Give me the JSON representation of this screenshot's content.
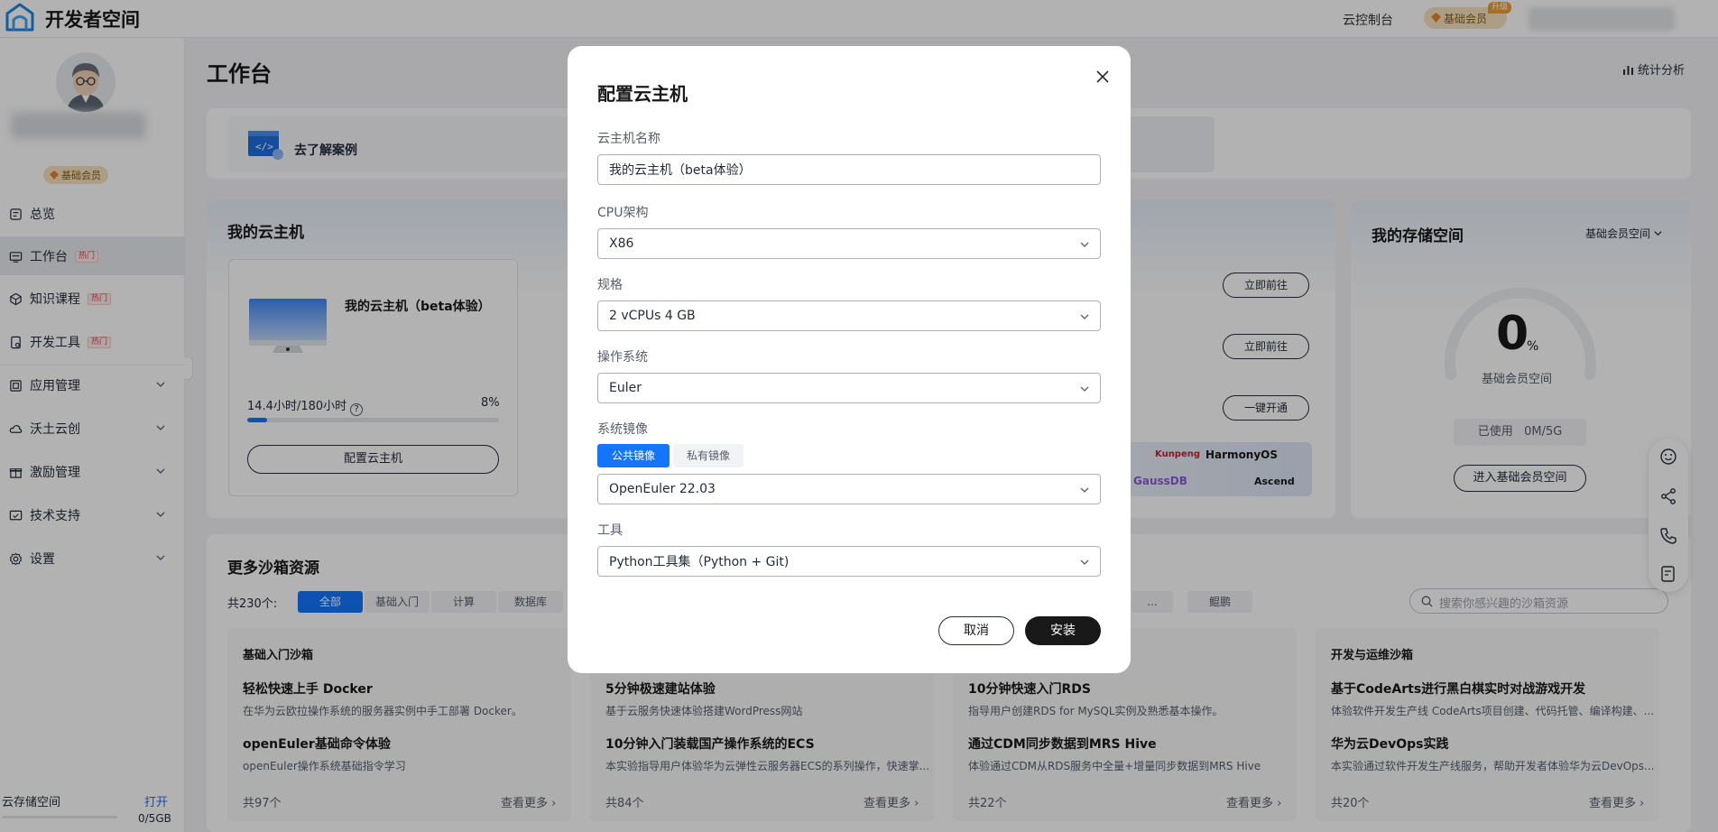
{
  "topbar": {
    "logo_text": "开发者空间",
    "console_link": "云控制台",
    "member_label": "基础会员",
    "upgrade_badge": "升级"
  },
  "sidebar": {
    "member_badge": "基础会员",
    "items": [
      {
        "label": "总览",
        "icon": "overview-icon"
      },
      {
        "label": "工作台",
        "hot": "热门",
        "icon": "workbench-icon"
      },
      {
        "label": "知识课程",
        "hot": "热门",
        "icon": "course-icon"
      },
      {
        "label": "开发工具",
        "hot": "热门",
        "icon": "dev-tools-icon"
      },
      {
        "label": "应用管理",
        "icon": "app-manage-icon"
      },
      {
        "label": "沃土云创",
        "icon": "cloud-icon"
      },
      {
        "label": "激励管理",
        "icon": "gift-icon"
      },
      {
        "label": "技术支持",
        "icon": "support-icon"
      },
      {
        "label": "设置",
        "icon": "gear-icon"
      }
    ],
    "storage": {
      "label": "云存储空间",
      "open_link": "打开",
      "usage": "0/5GB"
    }
  },
  "main": {
    "title": "工作台",
    "stats_link": "统计分析",
    "banner_case": "去了解案例",
    "vm": {
      "title": "我的云主机",
      "name": "我的云主机（beta体验）",
      "usage": "14.4小时/180小时",
      "percent": "8%",
      "percent_value": 0.08,
      "config_button": "配置云主机",
      "go_buttons": [
        "立即前往",
        "立即前往",
        "一键开通"
      ],
      "brands": [
        "Kunpeng",
        "HarmonyOS",
        "GaussDB",
        "Ascend"
      ]
    },
    "storage": {
      "title": "我的存储空间",
      "dropdown": "基础会员空间",
      "value": "0",
      "unit": "%",
      "label": "基础会员空间",
      "used": "已使用   0M/5G",
      "enter_button": "进入基础会员空间"
    },
    "sandbox": {
      "title": "更多沙箱资源",
      "count": "共230个:",
      "filters": [
        "全部",
        "基础入门",
        "计算",
        "数据库"
      ],
      "filters_right": [
        "...",
        "鲲鹏"
      ],
      "search_placeholder": "搜索你感兴趣的沙箱资源",
      "columns": [
        {
          "header": "基础入门沙箱",
          "items": [
            {
              "title": "轻松快速上手 Docker",
              "desc": "在华为云欧拉操作系统的服务器实例中手工部署 Docker。"
            },
            {
              "title": "openEuler基础命令体验",
              "desc": "openEuler操作系统基础指令学习"
            }
          ],
          "count": "共97个",
          "more": "查看更多"
        },
        {
          "header": "",
          "items": [
            {
              "title": "5分钟极速建站体验",
              "desc": "基于云服务快速体验搭建WordPress网站"
            },
            {
              "title": "10分钟入门装载国产操作系统的ECS",
              "desc": "本实验指导用户体验华为云弹性云服务器ECS的系列操作，快速掌..."
            }
          ],
          "count": "共84个",
          "more": "查看更多"
        },
        {
          "header": "",
          "items": [
            {
              "title": "10分钟快速入门RDS",
              "desc": "指导用户创建RDS for MySQL实例及熟悉基本操作。"
            },
            {
              "title": "通过CDM同步数据到MRS Hive",
              "desc": "体验通过CDM从RDS服务中全量+增量同步数据到MRS Hive"
            }
          ],
          "count": "共22个",
          "more": "查看更多"
        },
        {
          "header": "开发与运维沙箱",
          "items": [
            {
              "title": "基于CodeArts进行黑白棋实时对战游戏开发",
              "desc": "体验软件开发生产线 CodeArts项目创建、代码托管、编译构建、..."
            },
            {
              "title": "华为云DevOps实践",
              "desc": "本实验通过软件开发生产线服务，帮助开发者体验华为云DevOps..."
            }
          ],
          "count": "共20个",
          "more": "查看更多"
        }
      ]
    }
  },
  "modal": {
    "title": "配置云主机",
    "fields": {
      "name_label": "云主机名称",
      "name_value": "我的云主机（beta体验）",
      "cpu_label": "CPU架构",
      "cpu_value": "X86",
      "spec_label": "规格",
      "spec_value": "2 vCPUs 4 GB",
      "os_label": "操作系统",
      "os_value": "Euler",
      "image_label": "系统镜像",
      "image_tab_public": "公共镜像",
      "image_tab_private": "私有镜像",
      "image_value": "OpenEuler 22.03",
      "tool_label": "工具",
      "tool_value": "Python工具集（Python + Git)"
    },
    "cancel": "取消",
    "install": "安装"
  },
  "colors": {
    "accent": "#1476ff",
    "dark_button": "#191919",
    "overlay": "rgba(0,0,0,0.30)"
  }
}
